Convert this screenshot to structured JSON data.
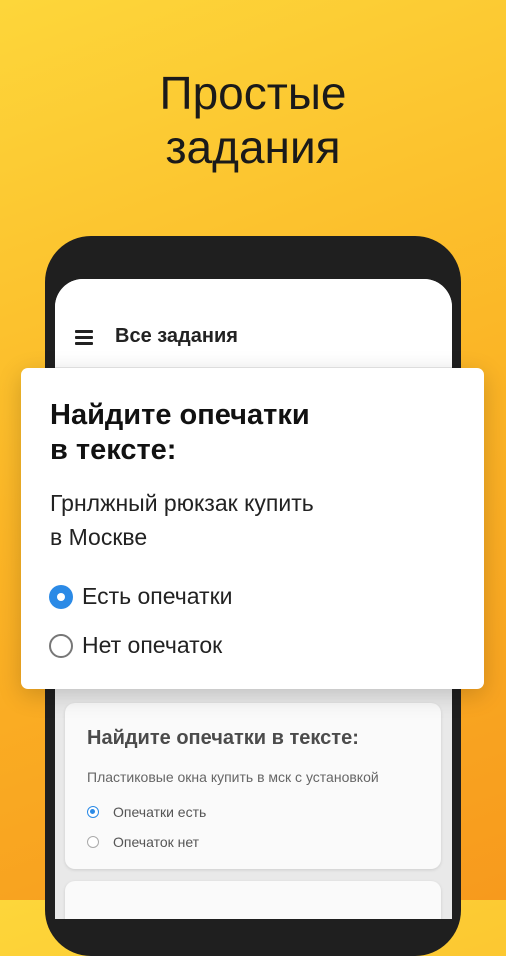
{
  "headline": {
    "line1": "Простые",
    "line2": "задания"
  },
  "appbar": {
    "menu_icon": "menu-icon",
    "title": "Все задания"
  },
  "task_card": {
    "title_line1": "Найдите опечатки",
    "title_line2": "в тексте:",
    "text_line1": "Грнлжный рюкзак купить",
    "text_line2": "в Москве",
    "options": [
      {
        "label": "Есть опечатки",
        "selected": true
      },
      {
        "label": "Нет опечаток",
        "selected": false
      }
    ]
  },
  "background_card": {
    "title": "Найдите опечатки в тексте:",
    "text": "Пластиковые окна купить в мск с установкой",
    "options": [
      {
        "label": "Опечатки есть",
        "selected": true
      },
      {
        "label": "Опечаток нет",
        "selected": false
      }
    ]
  },
  "colors": {
    "accent": "#2b8ae6",
    "background_top": "#fdd63a",
    "background_bottom": "#f79a1d"
  }
}
